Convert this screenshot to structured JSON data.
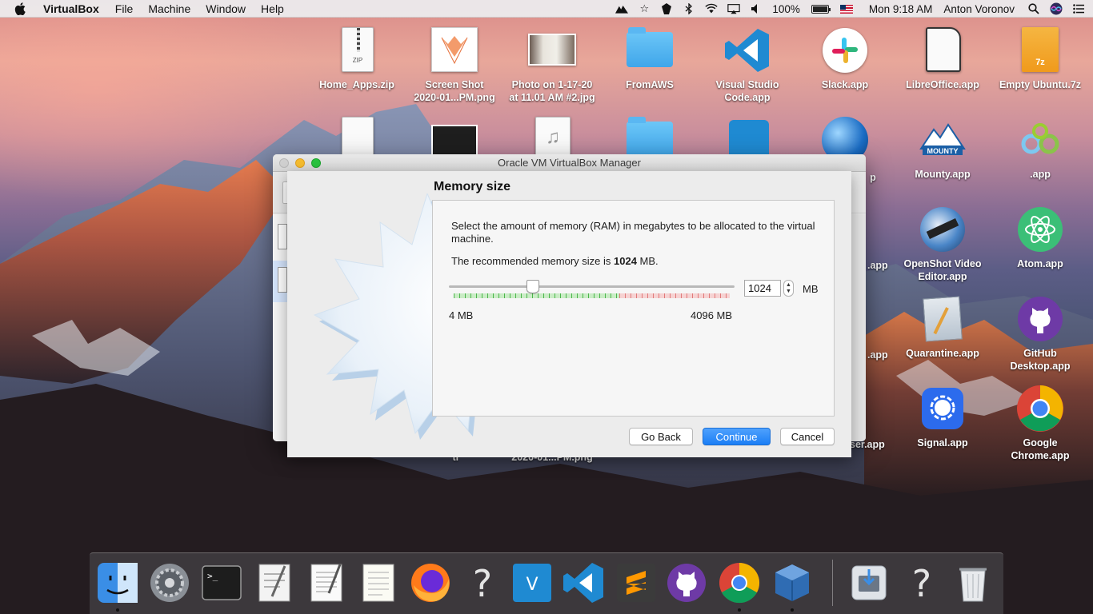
{
  "menubar": {
    "app_name": "VirtualBox",
    "menus": [
      "File",
      "Machine",
      "Window",
      "Help"
    ],
    "battery_percent": "100%",
    "clock": "Mon 9:18 AM",
    "user": "Anton Voronov"
  },
  "desktop": {
    "icons": [
      {
        "label": "Home_Apps.zip",
        "icon": "zip-icon"
      },
      {
        "label": "Screen Shot\n2020-01...PM.png",
        "icon": "screenshot-icon"
      },
      {
        "label": "Photo on 1-17-20\nat 11.01 AM #2.jpg",
        "icon": "photo-icon"
      },
      {
        "label": "FromAWS",
        "icon": "folder-icon"
      },
      {
        "label": "Visual Studio\nCode.app",
        "icon": "vscode-icon"
      },
      {
        "label": "Slack.app",
        "icon": "slack-icon"
      },
      {
        "label": "LibreOffice.app",
        "icon": "libreoffice-icon"
      },
      {
        "label": "Empty Ubuntu.7z",
        "icon": "archive-7z-icon"
      },
      {
        "label": "Mounty.app",
        "icon": "mounty-icon"
      },
      {
        "label": ".app",
        "icon": "app-icon"
      },
      {
        "label": "OpenShot Video\nEditor.app",
        "icon": "openshot-icon"
      },
      {
        "label": "Atom.app",
        "icon": "atom-icon"
      },
      {
        "label": "Quarantine.app",
        "icon": "quarantine-icon"
      },
      {
        "label": "GitHub\nDesktop.app",
        "icon": "github-icon"
      },
      {
        "label": "Signal.app",
        "icon": "signal-icon"
      },
      {
        "label": "Google\nChrome.app",
        "icon": "chrome-icon"
      }
    ],
    "partial_labels": [
      "p",
      ".app",
      ".app",
      "ser.app",
      "2020-01...PM.png",
      "tr"
    ]
  },
  "manager_window": {
    "title": "Oracle VM VirtualBox Manager"
  },
  "wizard": {
    "page_title": "Memory size",
    "description": "Select the amount of memory (RAM) in megabytes to be allocated to the virtual machine.",
    "recommend_prefix": "The recommended memory size is ",
    "recommend_value": "1024",
    "recommend_suffix": " MB.",
    "memory": {
      "min": 4,
      "max": 4096,
      "value": 1024,
      "value_text": "1024",
      "unit": "MB",
      "min_label": "4 MB",
      "max_label": "4096 MB",
      "safe_fraction": 0.6
    },
    "buttons": {
      "back": "Go Back",
      "continue": "Continue",
      "cancel": "Cancel"
    }
  },
  "dock": {
    "items": [
      {
        "icon": "finder-icon",
        "running": true
      },
      {
        "icon": "system-preferences-icon",
        "running": false
      },
      {
        "icon": "terminal-icon",
        "running": false
      },
      {
        "icon": "script-editor-icon",
        "running": false
      },
      {
        "icon": "textedit-icon",
        "running": false
      },
      {
        "icon": "notes-icon",
        "running": false
      },
      {
        "icon": "firefox-icon",
        "running": false
      },
      {
        "icon": "unknown-app-icon",
        "running": false
      },
      {
        "icon": "vscode-insiders-icon",
        "running": false
      },
      {
        "icon": "vscode-icon",
        "running": false
      },
      {
        "icon": "sublime-icon",
        "running": false
      },
      {
        "icon": "github-icon",
        "running": false
      },
      {
        "icon": "chrome-icon",
        "running": true
      },
      {
        "icon": "virtualbox-icon",
        "running": true
      },
      {
        "icon": "downloads-icon",
        "running": false
      },
      {
        "icon": "unknown-app-icon",
        "running": false
      },
      {
        "icon": "trash-icon",
        "running": false
      }
    ]
  }
}
